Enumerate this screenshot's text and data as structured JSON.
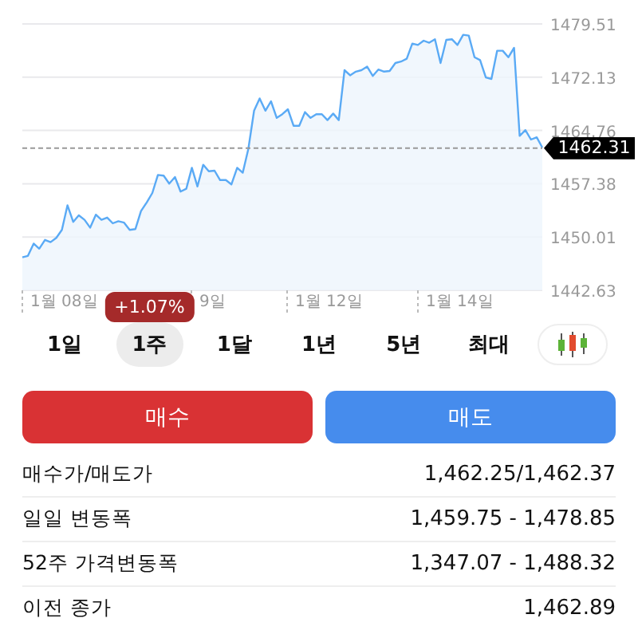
{
  "chart": {
    "chart_data": {
      "type": "area",
      "series": [
        {
          "color": "#5aaaf5",
          "values": [
            1447.2,
            1447.4,
            1449.1,
            1448.4,
            1449.6,
            1449.3,
            1449.9,
            1451.0,
            1454.4,
            1452.1,
            1453.0,
            1452.4,
            1451.3,
            1453.1,
            1452.4,
            1452.7,
            1451.9,
            1452.2,
            1452.0,
            1451.0,
            1451.1,
            1453.6,
            1454.8,
            1456.1,
            1458.6,
            1458.5,
            1457.4,
            1458.3,
            1456.3,
            1456.7,
            1459.6,
            1457.0,
            1460.0,
            1459.1,
            1459.2,
            1457.9,
            1457.9,
            1457.3,
            1459.6,
            1458.9,
            1462.2,
            1467.5,
            1469.2,
            1467.5,
            1468.8,
            1466.5,
            1467.0,
            1467.7,
            1465.4,
            1465.4,
            1467.3,
            1466.5,
            1467.0,
            1467.0,
            1466.2,
            1467.1,
            1466.2,
            1473.1,
            1472.4,
            1472.9,
            1473.1,
            1473.6,
            1472.3,
            1473.2,
            1472.9,
            1473.0,
            1474.1,
            1474.3,
            1474.7,
            1476.8,
            1476.6,
            1477.2,
            1476.9,
            1477.4,
            1474.1,
            1477.3,
            1477.4,
            1476.6,
            1478.0,
            1477.9,
            1474.9,
            1474.5,
            1472.1,
            1471.9,
            1475.8,
            1475.8,
            1474.9,
            1476.2,
            1464.0,
            1464.8,
            1463.5,
            1463.8,
            1462.4
          ]
        }
      ],
      "ylim": [
        1442.63,
        1479.51
      ],
      "yticks": [
        1442.63,
        1450.01,
        1457.38,
        1464.76,
        1472.13,
        1479.51
      ],
      "grid": true,
      "ref_lines": [
        {
          "axis": "y",
          "value": 1462.31,
          "label": "1462.31"
        }
      ]
    },
    "x_labels": [
      "1월 08일",
      "9일",
      "1월 12일",
      "1월 14일"
    ]
  },
  "change_badge": "+1.07%",
  "period_tabs": [
    {
      "label": "1일",
      "selected": false
    },
    {
      "label": "1주",
      "selected": true
    },
    {
      "label": "1달",
      "selected": false
    },
    {
      "label": "1년",
      "selected": false
    },
    {
      "label": "5년",
      "selected": false
    },
    {
      "label": "최대",
      "selected": false
    }
  ],
  "actions": [
    {
      "label": "매수",
      "kind": "buy"
    },
    {
      "label": "매도",
      "kind": "sell"
    }
  ],
  "stats": [
    {
      "label": "매수가/매도가",
      "value": "1,462.25/1,462.37"
    },
    {
      "label": "일일 변동폭",
      "value": "1,459.75 - 1,478.85"
    },
    {
      "label": "52주 가격변동폭",
      "value": "1,347.07 - 1,488.32"
    },
    {
      "label": "이전 종가",
      "value": "1,462.89"
    }
  ]
}
